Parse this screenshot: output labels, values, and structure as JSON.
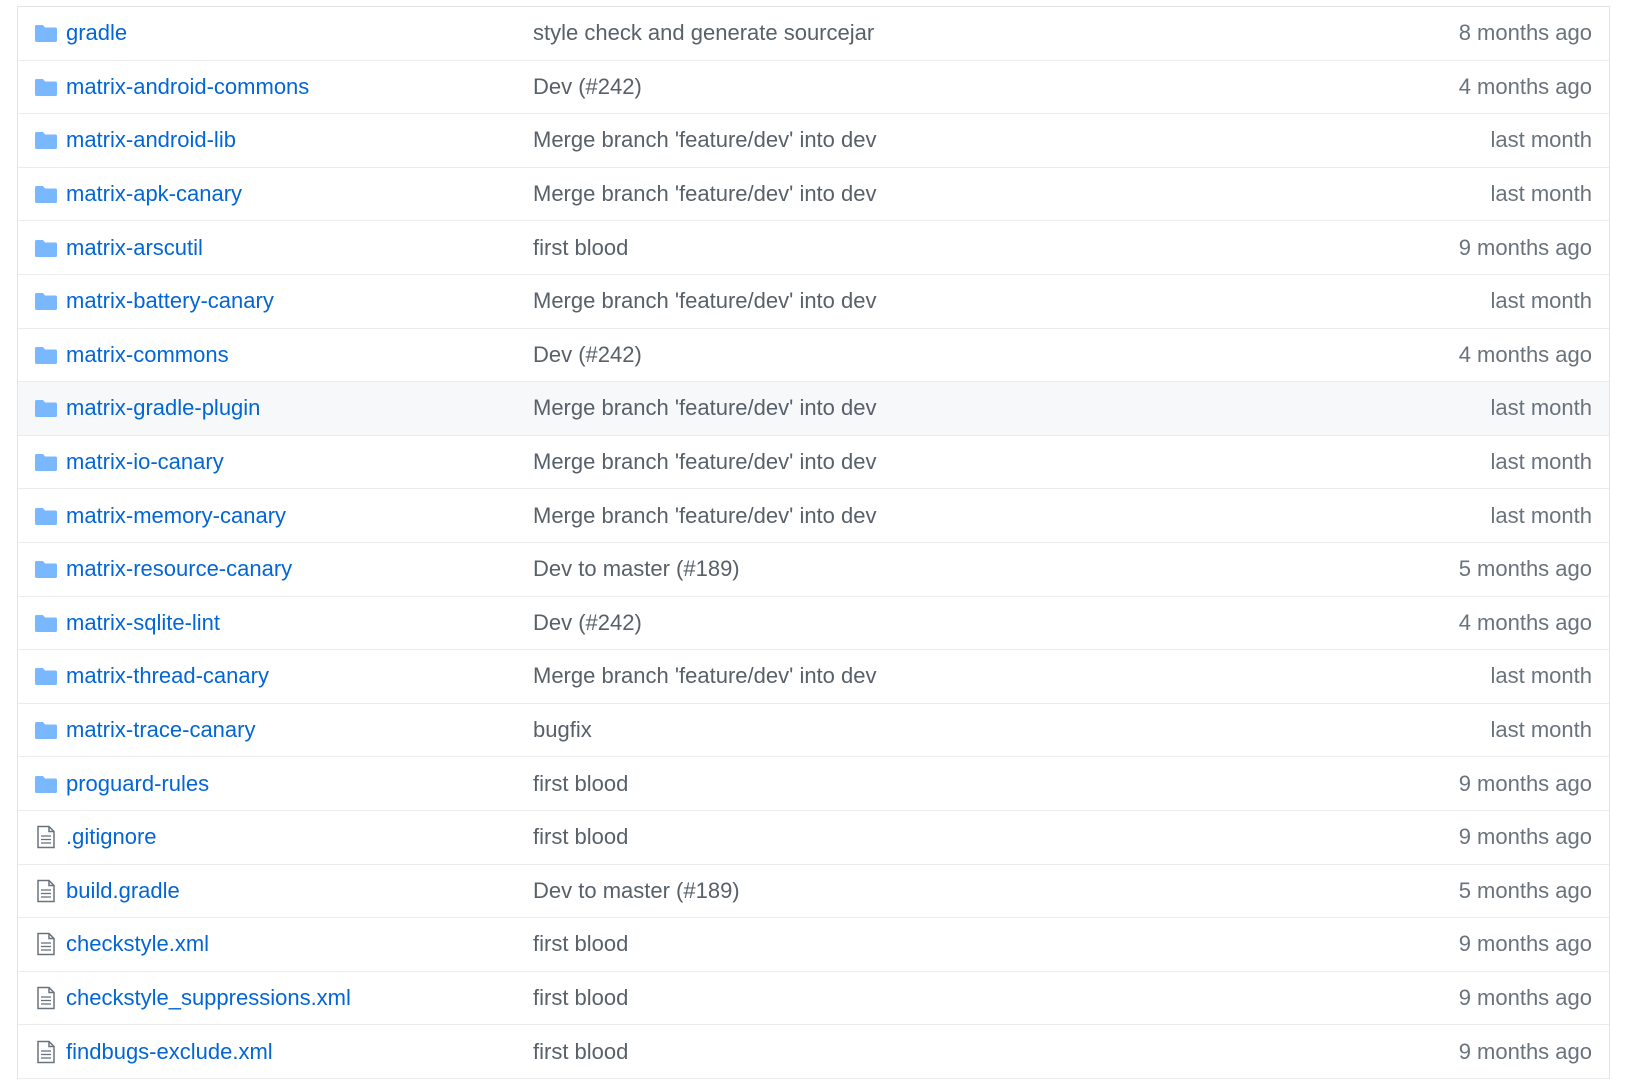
{
  "colors": {
    "link": "#0366d6",
    "message": "#586069",
    "age": "#6a737d",
    "folder_icon": "#79b8ff",
    "file_icon": "#6a737d",
    "border": "#eaecef",
    "hover_row": "#f6f8fa"
  },
  "files": [
    {
      "type": "folder",
      "icon": "folder-icon",
      "name": "gradle",
      "message": "style check and generate sourcejar",
      "age": "8 months ago"
    },
    {
      "type": "folder",
      "icon": "folder-icon",
      "name": "matrix-android-commons",
      "message": "Dev (#242)",
      "age": "4 months ago"
    },
    {
      "type": "folder",
      "icon": "folder-icon",
      "name": "matrix-android-lib",
      "message": "Merge branch 'feature/dev' into dev",
      "age": "last month"
    },
    {
      "type": "folder",
      "icon": "folder-icon",
      "name": "matrix-apk-canary",
      "message": "Merge branch 'feature/dev' into dev",
      "age": "last month"
    },
    {
      "type": "folder",
      "icon": "folder-icon",
      "name": "matrix-arscutil",
      "message": "first blood",
      "age": "9 months ago"
    },
    {
      "type": "folder",
      "icon": "folder-icon",
      "name": "matrix-battery-canary",
      "message": "Merge branch 'feature/dev' into dev",
      "age": "last month"
    },
    {
      "type": "folder",
      "icon": "folder-icon",
      "name": "matrix-commons",
      "message": "Dev (#242)",
      "age": "4 months ago"
    },
    {
      "type": "folder",
      "icon": "folder-icon",
      "name": "matrix-gradle-plugin",
      "message": "Merge branch 'feature/dev' into dev",
      "age": "last month"
    },
    {
      "type": "folder",
      "icon": "folder-icon",
      "name": "matrix-io-canary",
      "message": "Merge branch 'feature/dev' into dev",
      "age": "last month"
    },
    {
      "type": "folder",
      "icon": "folder-icon",
      "name": "matrix-memory-canary",
      "message": "Merge branch 'feature/dev' into dev",
      "age": "last month"
    },
    {
      "type": "folder",
      "icon": "folder-icon",
      "name": "matrix-resource-canary",
      "message": "Dev to master (#189)",
      "age": "5 months ago"
    },
    {
      "type": "folder",
      "icon": "folder-icon",
      "name": "matrix-sqlite-lint",
      "message": "Dev (#242)",
      "age": "4 months ago"
    },
    {
      "type": "folder",
      "icon": "folder-icon",
      "name": "matrix-thread-canary",
      "message": "Merge branch 'feature/dev' into dev",
      "age": "last month"
    },
    {
      "type": "folder",
      "icon": "folder-icon",
      "name": "matrix-trace-canary",
      "message": "bugfix",
      "age": "last month"
    },
    {
      "type": "folder",
      "icon": "folder-icon",
      "name": "proguard-rules",
      "message": "first blood",
      "age": "9 months ago"
    },
    {
      "type": "file",
      "icon": "file-icon",
      "name": ".gitignore",
      "message": "first blood",
      "age": "9 months ago"
    },
    {
      "type": "file",
      "icon": "file-icon",
      "name": "build.gradle",
      "message": "Dev to master (#189)",
      "age": "5 months ago"
    },
    {
      "type": "file",
      "icon": "file-icon",
      "name": "checkstyle.xml",
      "message": "first blood",
      "age": "9 months ago"
    },
    {
      "type": "file",
      "icon": "file-icon",
      "name": "checkstyle_suppressions.xml",
      "message": "first blood",
      "age": "9 months ago"
    },
    {
      "type": "file",
      "icon": "file-icon",
      "name": "findbugs-exclude.xml",
      "message": "first blood",
      "age": "9 months ago"
    }
  ],
  "hovered_row": "matrix-gradle-plugin"
}
